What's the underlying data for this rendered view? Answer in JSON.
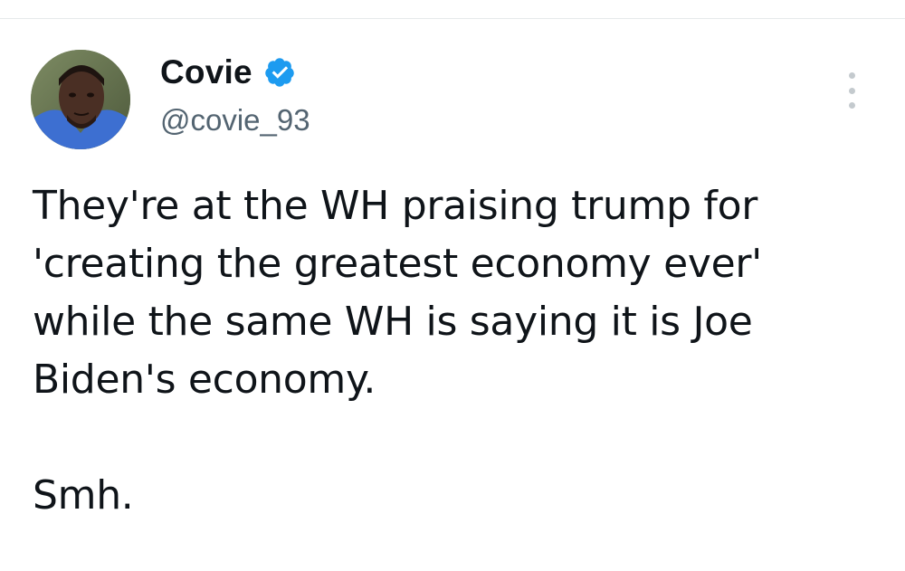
{
  "tweet": {
    "author": {
      "display_name": "Covie",
      "handle": "@covie_93",
      "verified": true,
      "verified_color": "#1d9bf0",
      "avatar_icon": "user-avatar"
    },
    "more_icon": "more-vertical-icon",
    "text_lines": [
      "They're at the WH praising trump for",
      "'creating the greatest economy ever'",
      "while the same WH is saying it is Joe",
      "Biden's economy."
    ],
    "closing_line": "Smh."
  }
}
